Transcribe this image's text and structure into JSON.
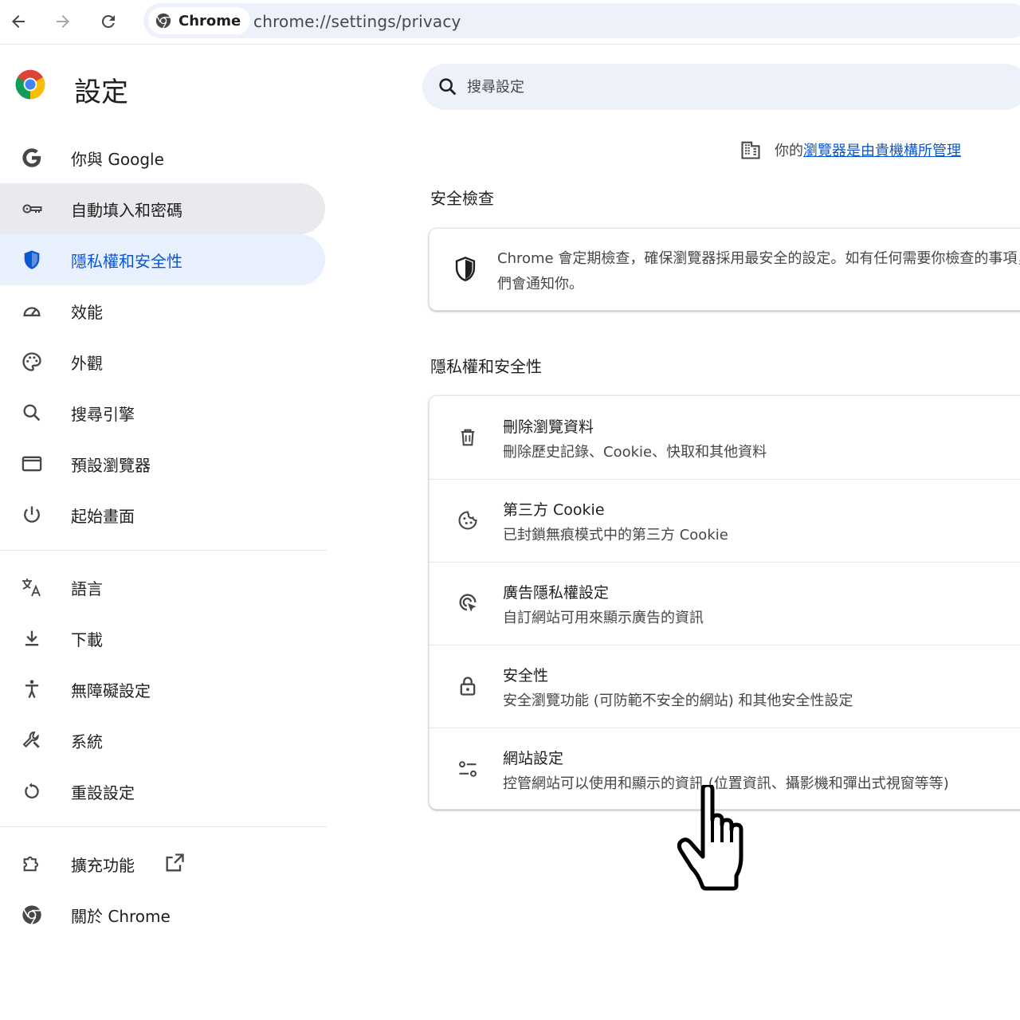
{
  "toolbar": {
    "site_chip": "Chrome",
    "url": "chrome://settings/privacy"
  },
  "sidebar": {
    "title": "設定",
    "items": [
      {
        "label": "你與 Google",
        "icon": "google-g-icon"
      },
      {
        "label": "自動填入和密碼",
        "icon": "key-icon"
      },
      {
        "label": "隱私權和安全性",
        "icon": "shield-icon"
      },
      {
        "label": "效能",
        "icon": "speedometer-icon"
      },
      {
        "label": "外觀",
        "icon": "palette-icon"
      },
      {
        "label": "搜尋引擎",
        "icon": "search-icon"
      },
      {
        "label": "預設瀏覽器",
        "icon": "browser-window-icon"
      },
      {
        "label": "起始畫面",
        "icon": "power-icon"
      },
      {
        "label": "語言",
        "icon": "translate-icon"
      },
      {
        "label": "下載",
        "icon": "download-icon"
      },
      {
        "label": "無障礙設定",
        "icon": "accessibility-icon"
      },
      {
        "label": "系統",
        "icon": "wrench-icon"
      },
      {
        "label": "重設設定",
        "icon": "reset-icon"
      },
      {
        "label": "擴充功能",
        "icon": "puzzle-icon"
      },
      {
        "label": "關於 Chrome",
        "icon": "chrome-icon"
      }
    ]
  },
  "search": {
    "placeholder": "搜尋設定"
  },
  "managed": {
    "prefix": "你的",
    "link": "瀏覽器是由貴機構所管理"
  },
  "safety_check": {
    "title": "安全檢查",
    "text": "Chrome 會定期檢查，確保瀏覽器採用最安全的設定。如有任何需要你檢查的事項，我們會通知你。"
  },
  "privacy": {
    "title": "隱私權和安全性",
    "rows": [
      {
        "title": "刪除瀏覽資料",
        "subtitle": "刪除歷史記錄、Cookie、快取和其他資料",
        "icon": "trash-icon"
      },
      {
        "title": "第三方 Cookie",
        "subtitle": "已封鎖無痕模式中的第三方 Cookie",
        "icon": "cookie-icon"
      },
      {
        "title": "廣告隱私權設定",
        "subtitle": "自訂網站可用來顯示廣告的資訊",
        "icon": "ad-privacy-icon"
      },
      {
        "title": "安全性",
        "subtitle": "安全瀏覽功能 (可防範不安全的網站) 和其他安全性設定",
        "icon": "lock-icon"
      },
      {
        "title": "網站設定",
        "subtitle": "控管網站可以使用和顯示的資訊 (位置資訊、攝影機和彈出式視窗等等)",
        "icon": "site-settings-icon"
      }
    ]
  },
  "colors": {
    "accent": "#0b57d0",
    "active_bg": "#e8f0fe",
    "hover_bg": "#e8eaed",
    "search_bg": "#edf2fa"
  }
}
